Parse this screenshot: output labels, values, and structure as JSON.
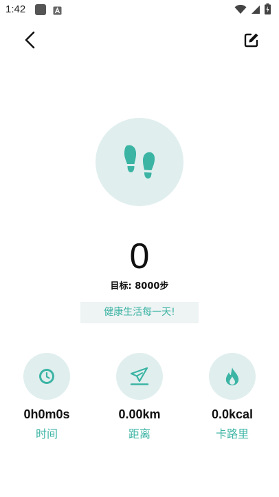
{
  "status_bar": {
    "time": "1:42",
    "icons": [
      "notification-square-icon",
      "a-icon",
      "wifi-icon",
      "signal-icon",
      "battery-icon"
    ]
  },
  "top_bar": {
    "back_icon": "chevron-left-icon",
    "edit_icon": "edit-icon"
  },
  "hero": {
    "icon": "footprints-icon",
    "steps": "0",
    "goal": "目标: 8000步",
    "motto": "健康生活每一天!"
  },
  "stats": [
    {
      "icon": "clock-icon",
      "value": "0h0m0s",
      "label": "时间"
    },
    {
      "icon": "paper-plane-icon",
      "value": "0.00km",
      "label": "距离"
    },
    {
      "icon": "flame-icon",
      "value": "0.0kcal",
      "label": "卡路里"
    }
  ],
  "colors": {
    "accent": "#3bb4a4",
    "circle_bg": "#e0eeee",
    "motto_bg": "#eef3f3"
  }
}
